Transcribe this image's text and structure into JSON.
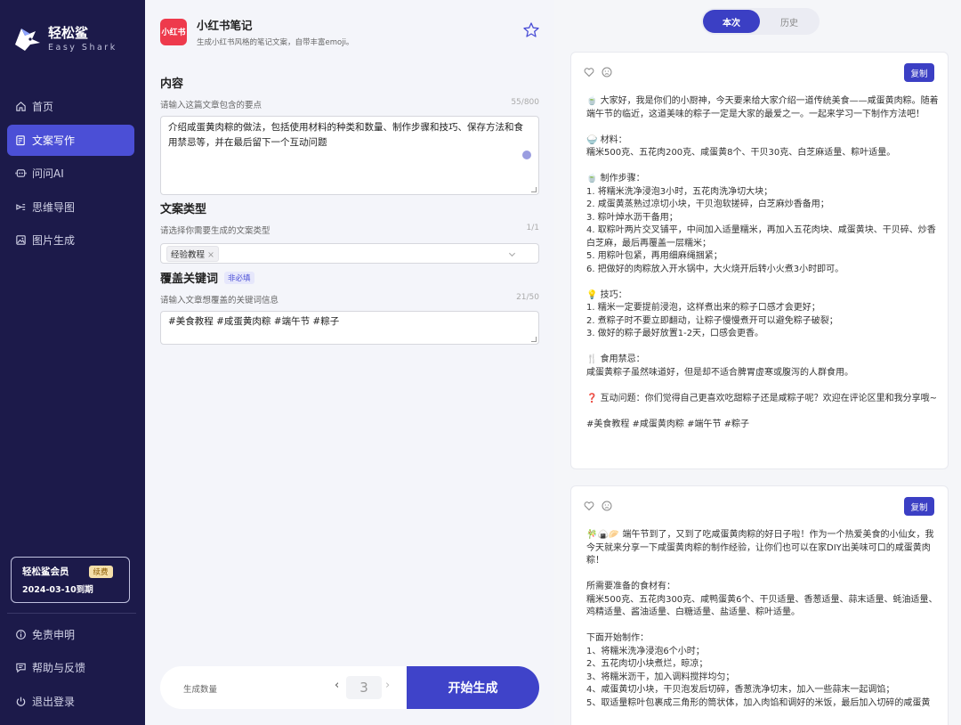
{
  "sidebar": {
    "brand_name": "轻松鲨",
    "brand_sub": "Easy Shark",
    "nav": [
      {
        "label": "首页",
        "icon": "home-icon"
      },
      {
        "label": "文案写作",
        "icon": "document-edit-icon"
      },
      {
        "label": "问问AI",
        "icon": "ai-chat-icon"
      },
      {
        "label": "思维导图",
        "icon": "mindmap-icon"
      },
      {
        "label": "图片生成",
        "icon": "image-icon"
      }
    ],
    "active_index": 1,
    "member": {
      "title": "轻松鲨会员",
      "renew_label": "续费",
      "expiry": "2024-03-10到期"
    },
    "bottom": [
      {
        "label": "免责申明",
        "icon": "info-icon"
      },
      {
        "label": "帮助与反馈",
        "icon": "feedback-icon"
      },
      {
        "label": "退出登录",
        "icon": "power-icon"
      }
    ]
  },
  "tool": {
    "logo_text": "小红书",
    "title": "小红书笔记",
    "subtitle": "生成小红书风格的笔记文案，自带丰富emoji。"
  },
  "form": {
    "content": {
      "title": "内容",
      "hint": "请输入这篇文章包含的要点",
      "count": "55/800",
      "value": "介绍咸蛋黄肉粽的做法，包括使用材料的种类和数量、制作步骤和技巧、保存方法和食用禁忌等，并在最后留下一个互动问题"
    },
    "type": {
      "title": "文案类型",
      "hint": "请选择你需要生成的文案类型",
      "count": "1/1",
      "selected_tag": "经验教程"
    },
    "keywords": {
      "title": "覆盖关键词",
      "optional_badge": "非必填",
      "hint": "请输入文章想覆盖的关键词信息",
      "count": "21/50",
      "value": "#美食教程 #咸蛋黄肉粽 #端午节 #粽子"
    },
    "generate": {
      "count_label": "生成数量",
      "count_value": "3",
      "start_label": "开始生成"
    }
  },
  "results": {
    "tabs": [
      "本次",
      "历史"
    ],
    "active_tab": 0,
    "copy_label": "复制",
    "cards": [
      {
        "text": "🍵 大家好，我是你们的小厨神，今天要来给大家介绍一道传统美食——咸蛋黄肉粽。随着端午节的临近，这道美味的粽子一定是大家的最爱之一。一起来学习一下制作方法吧！\n\n🍚 材料：\n糯米500克、五花肉200克、咸蛋黄8个、干贝30克、白芝麻适量、粽叶适量。\n\n🍵 制作步骤：\n1. 将糯米洗净浸泡3小时，五花肉洗净切大块；\n2. 咸蛋黄蒸熟过凉切小块，干贝泡软搓碎，白芝麻炒香备用；\n3. 粽叶焯水沥干备用；\n4. 取粽叶两片交叉铺平，中间加入适量糯米，再加入五花肉块、咸蛋黄块、干贝碎、炒香白芝麻，最后再覆盖一层糯米；\n5. 用粽叶包紧，再用细麻绳捆紧；\n6. 把做好的肉粽放入开水锅中，大火烧开后转小火煮3小时即可。\n\n💡 技巧：\n1. 糯米一定要提前浸泡，这样煮出来的粽子口感才会更好；\n2. 煮粽子时不要立即翻动，让粽子慢慢煮开可以避免粽子破裂；\n3. 做好的粽子最好放置1-2天，口感会更香。\n\n🍴 食用禁忌：\n咸蛋黄粽子虽然味道好，但是却不适合脾胃虚寒或腹泻的人群食用。\n\n❓ 互动问题：你们觉得自己更喜欢吃甜粽子还是咸粽子呢？欢迎在评论区里和我分享哦~\n\n#美食教程 #咸蛋黄肉粽 #端午节 #粽子"
      },
      {
        "text": "🎋🍙🥟 端午节到了，又到了吃咸蛋黄肉粽的好日子啦！作为一个热爱美食的小仙女，我今天就来分享一下咸蛋黄肉粽的制作经验，让你们也可以在家DIY出美味可口的咸蛋黄肉粽！\n\n所需要准备的食材有：\n糯米500克、五花肉300克、咸鸭蛋黄6个、干贝适量、香葱适量、蒜末适量、蚝油适量、鸡精适量、酱油适量、白糖适量、盐适量、粽叶适量。\n\n下面开始制作：\n1、将糯米洗净浸泡6个小时；\n2、五花肉切小块煮烂，晾凉；\n3、将糯米沥干，加入调料搅拌均匀；\n4、咸蛋黄切小块，干贝泡发后切碎，香葱洗净切末，加入一些蒜末一起调馅；\n5、取适量粽叶包裹成三角形的筒状体，加入肉馅和调好的米饭，最后加入切碎的咸蛋黄"
      }
    ]
  }
}
